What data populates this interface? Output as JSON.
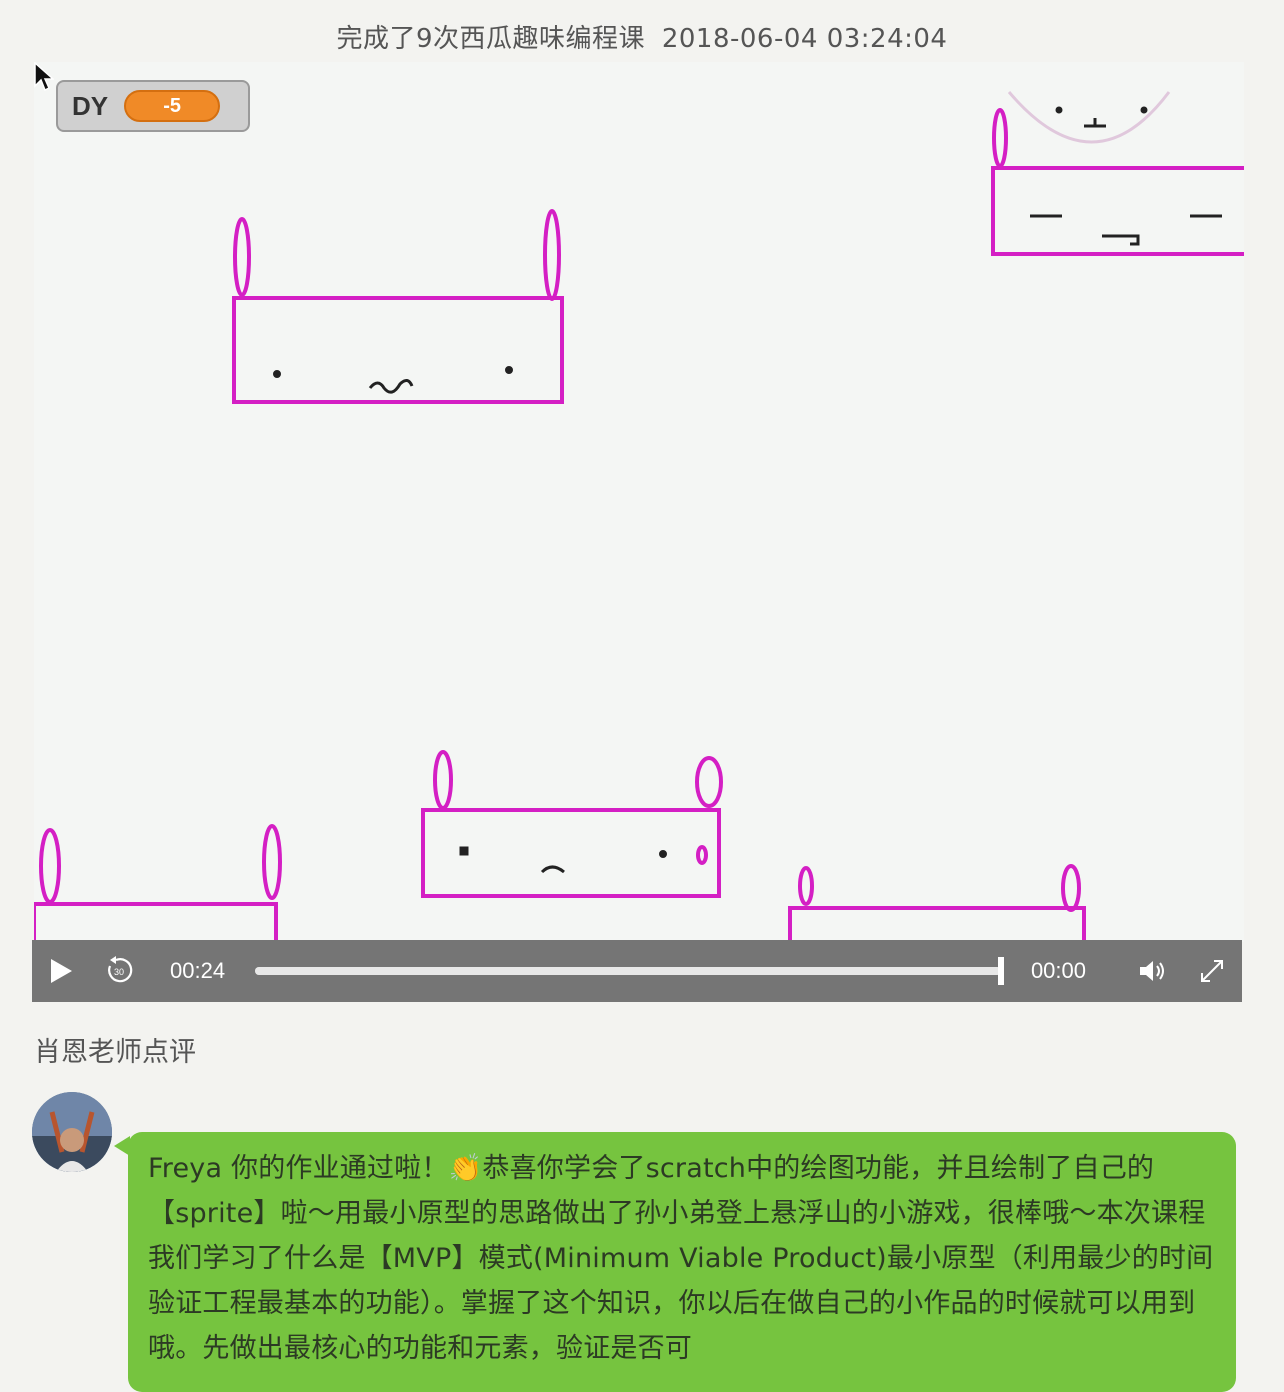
{
  "header": {
    "completion_text": "完成了9次西瓜趣味编程课",
    "timestamp": "2018-06-04 03:24:04"
  },
  "stage": {
    "variable_monitor": {
      "name": "DY",
      "value": "-5"
    }
  },
  "player": {
    "current_time": "00:24",
    "remaining_time": "00:00",
    "progress_percent": 100,
    "icons": [
      "play-icon",
      "replay-30-icon",
      "volume-icon",
      "fullscreen-icon"
    ]
  },
  "review": {
    "title": "肖恩老师点评",
    "comment": "Freya 你的作业通过啦！👏恭喜你学会了scratch中的绘图功能，并且绘制了自己的【sprite】啦～用最小原型的思路做出了孙小弟登上悬浮山的小游戏，很棒哦～本次课程我们学习了什么是【MVP】模式(Minimum Viable Product)最小原型（利用最少的时间验证工程最基本的功能）。掌握了这个知识，你以后在做自己的小作品的时候就可以用到哦。先做出最核心的功能和元素，验证是否可"
  },
  "colors": {
    "sprite_stroke": "#d41fc4",
    "controls_bg": "#757575",
    "bubble_bg": "#76c43f",
    "monitor_value_bg": "#f08a27"
  }
}
